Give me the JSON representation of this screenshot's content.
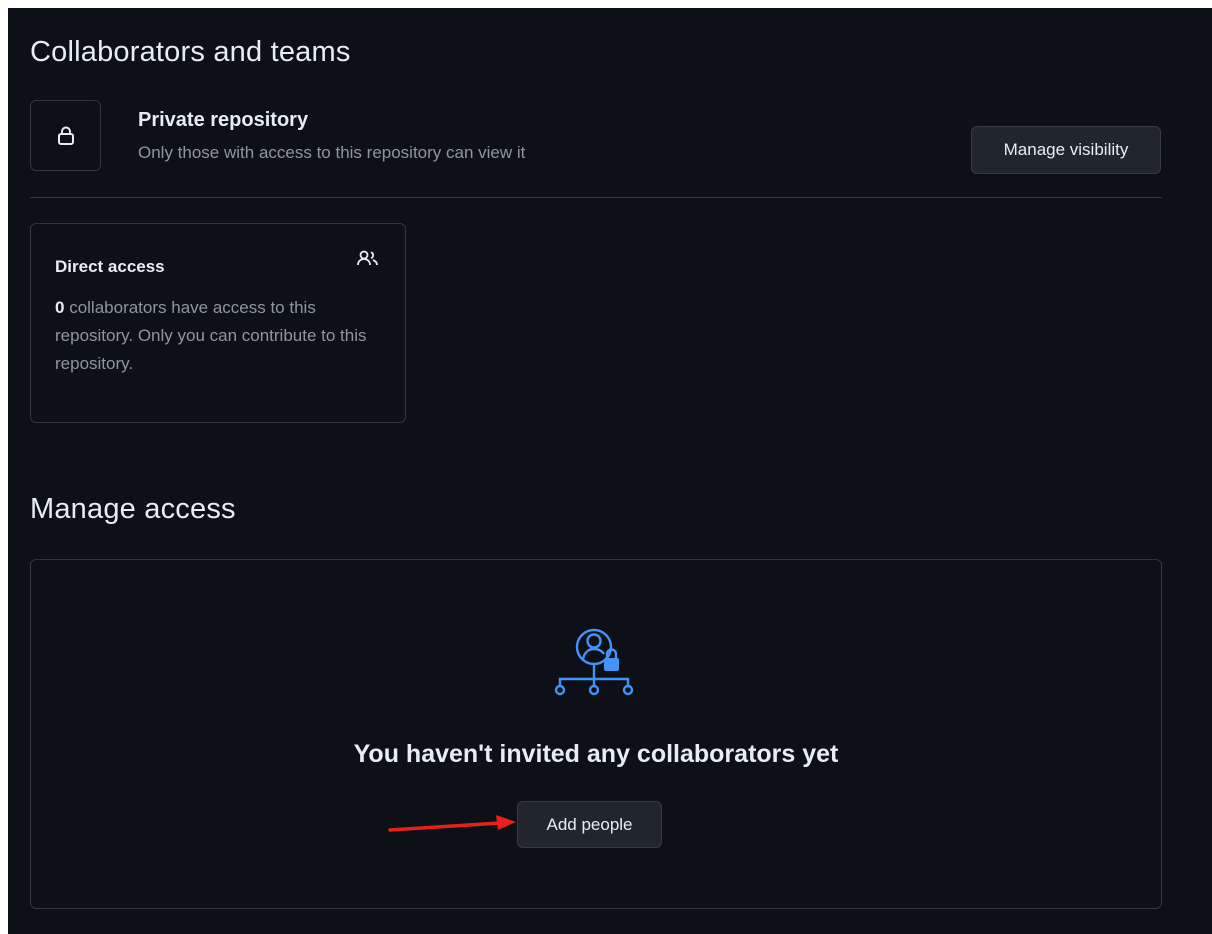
{
  "collaborators": {
    "heading": "Collaborators and teams",
    "visibility": {
      "icon": "lock-icon",
      "title": "Private repository",
      "description": "Only those with access to this repository can view it",
      "manage_button": "Manage visibility"
    },
    "direct_access": {
      "title": "Direct access",
      "icon": "people-icon",
      "count": "0",
      "text": " collaborators have access to this repository. Only you can contribute to this repository."
    }
  },
  "manage_access": {
    "heading": "Manage access",
    "empty_state": {
      "icon": "person-lock-network-icon",
      "title": "You haven't invited any collaborators yet",
      "button": "Add people"
    },
    "annotation": {
      "icon": "red-arrow-icon",
      "color": "#e8201a"
    }
  },
  "theme": {
    "background": "#0d1117",
    "border": "#30363d",
    "text": "#e6edf3",
    "muted": "#8d96a0",
    "accent_blue": "#4493f8"
  }
}
